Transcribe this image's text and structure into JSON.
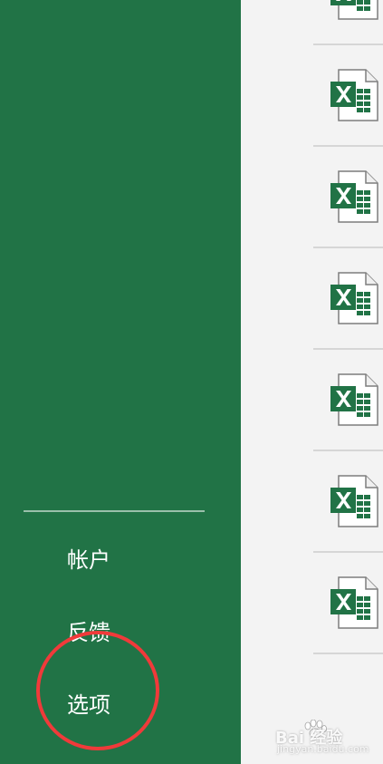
{
  "sidebar": {
    "items": [
      {
        "label": "帐户"
      },
      {
        "label": "反馈"
      },
      {
        "label": "选项"
      }
    ],
    "background": "#217346"
  },
  "files": {
    "icon": "excel-file-icon",
    "count": 7
  },
  "annotation": {
    "color": "#f03a3a"
  },
  "watermark": {
    "main": "Bai 经验",
    "sub": "jingyan.baidu.com"
  }
}
